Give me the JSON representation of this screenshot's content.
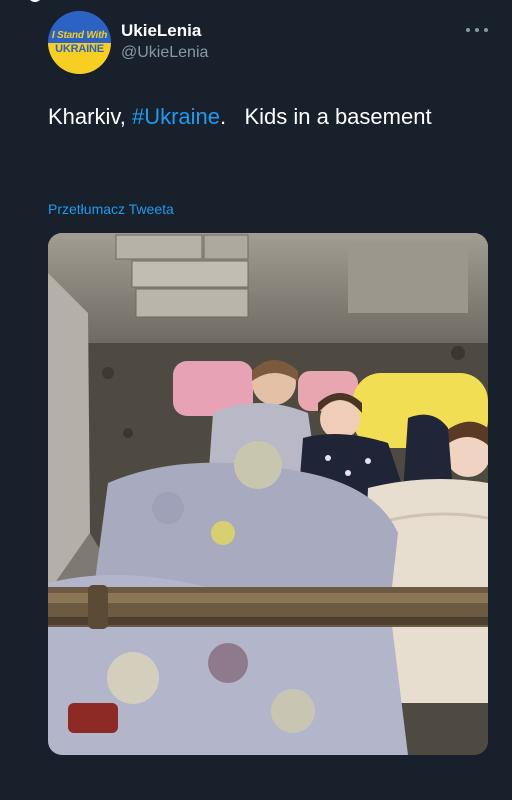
{
  "author": {
    "display_name": "UkieLenia",
    "handle": "@UkieLenia",
    "avatar_text_top": "I Stand With",
    "avatar_text_bottom": "UKRAINE"
  },
  "tweet": {
    "text_before": "Kharkiv, ",
    "hashtag": "#Ukraine",
    "text_after": ".   Kids in a basement"
  },
  "translate_label": "Przetłumacz Tweeta",
  "colors": {
    "background": "#17202b",
    "link": "#1d9bf0",
    "secondary_text": "#8899a6"
  },
  "icons": {
    "more": "more-horizontal-icon"
  }
}
